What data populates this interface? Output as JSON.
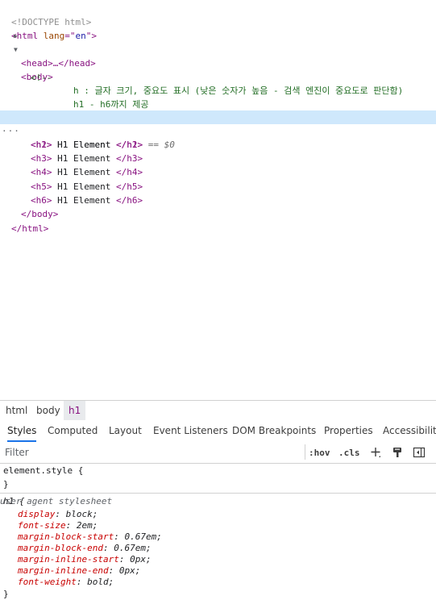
{
  "dom_tree": {
    "doctype": "<!DOCTYPE html>",
    "html_open_tag": "<html",
    "html_lang_attr": "lang",
    "html_lang_eq": "=\"",
    "html_lang_val": "en",
    "html_lang_close": "\">",
    "head_collapsed": "<head>…</head>",
    "body_open": "<body>",
    "comment_open": "<!--",
    "comment_line1": "h : 글자 크기, 중요도 표시 (낮은 숫자가 높음 - 검색 엔진이 중요도로 판단함)",
    "comment_line2": "h1 - h6까지 제공",
    "comment_close": "-->",
    "headings": [
      {
        "open": "<h1>",
        "text": " H1 Element ",
        "close": "</h1>"
      },
      {
        "open": "<h2>",
        "text": " H1 Element ",
        "close": "</h2>"
      },
      {
        "open": "<h3>",
        "text": " H1 Element ",
        "close": "</h3>"
      },
      {
        "open": "<h4>",
        "text": " H1 Element ",
        "close": "</h4>"
      },
      {
        "open": "<h5>",
        "text": " H1 Element ",
        "close": "</h5>"
      },
      {
        "open": "<h6>",
        "text": " H1 Element ",
        "close": "</h6>"
      }
    ],
    "selected_marker": " == $0",
    "body_close": "</body>",
    "html_close": "</html>",
    "ellipsis": "···"
  },
  "breadcrumbs": [
    "html",
    "body",
    "h1"
  ],
  "tabs": [
    "Styles",
    "Computed",
    "Layout",
    "Event Listeners",
    "DOM Breakpoints",
    "Properties",
    "Accessibility"
  ],
  "filter": {
    "placeholder": "Filter",
    "hov": ":hov",
    "cls": ".cls"
  },
  "styles": {
    "element_style_selector": "element.style {",
    "close_brace": "}",
    "h1_selector": "h1 {",
    "origin": "user agent stylesheet",
    "declarations": [
      {
        "prop": "display",
        "value": "block;"
      },
      {
        "prop": "font-size",
        "value": "2em;"
      },
      {
        "prop": "margin-block-start",
        "value": "0.67em;"
      },
      {
        "prop": "margin-block-end",
        "value": "0.67em;"
      },
      {
        "prop": "margin-inline-start",
        "value": "0px;"
      },
      {
        "prop": "margin-inline-end",
        "value": "0px;"
      },
      {
        "prop": "font-weight",
        "value": "bold;"
      }
    ]
  },
  "colors": {
    "tag": "#881280",
    "attr_name": "#994500",
    "attr_value": "#1a1aa6",
    "comment": "#236e25",
    "selected_row": "#cfe8fc",
    "active_tab_underline": "#1a73e8",
    "css_property": "#c80000"
  }
}
